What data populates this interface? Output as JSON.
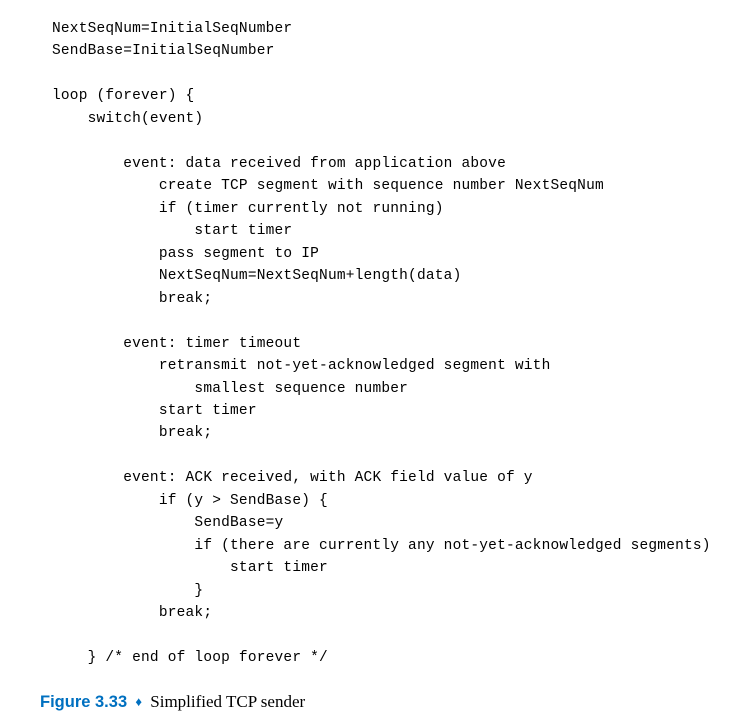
{
  "code": {
    "line1": "NextSeqNum=InitialSeqNumber",
    "line2": "SendBase=InitialSeqNumber",
    "line3": "",
    "line4": "loop (forever) {",
    "line5": "    switch(event)",
    "line6": "",
    "line7": "        event: data received from application above",
    "line8": "            create TCP segment with sequence number NextSeqNum",
    "line9": "            if (timer currently not running)",
    "line10": "                start timer",
    "line11": "            pass segment to IP",
    "line12": "            NextSeqNum=NextSeqNum+length(data)",
    "line13": "            break;",
    "line14": "",
    "line15": "        event: timer timeout",
    "line16": "            retransmit not-yet-acknowledged segment with",
    "line17": "                smallest sequence number",
    "line18": "            start timer",
    "line19": "            break;",
    "line20": "",
    "line21": "        event: ACK received, with ACK field value of y",
    "line22": "            if (y > SendBase) {",
    "line23": "                SendBase=y",
    "line24": "                if (there are currently any not-yet-acknowledged segments)",
    "line25": "                    start timer",
    "line26": "                }",
    "line27": "            break;",
    "line28": "",
    "line29": "    } /* end of loop forever */"
  },
  "caption": {
    "label": "Figure 3.33",
    "diamond": "♦",
    "text": "Simplified TCP sender"
  }
}
